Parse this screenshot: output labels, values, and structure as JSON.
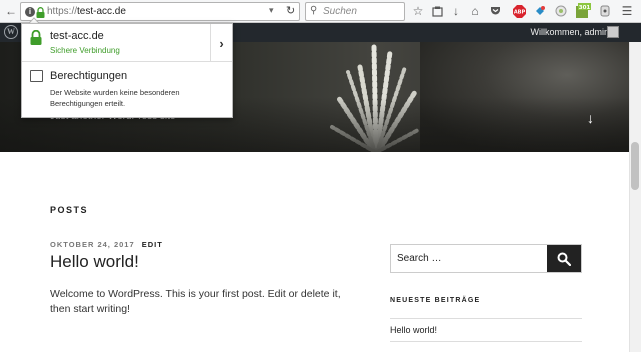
{
  "browser": {
    "url_scheme": "https://",
    "url_host": "test-acc.de",
    "search_placeholder": "Suchen",
    "colors": {
      "lock_green": "#3f9d2a"
    }
  },
  "toolbar_icons": [
    "back-icon",
    "bookmark-star-icon",
    "reading-list-icon",
    "download-icon",
    "home-icon",
    "pocket-icon",
    "adblock-icon",
    "extension-icon",
    "extension-icon",
    "extension-icon",
    "menu-icon"
  ],
  "extension_badge": "301",
  "identity_popup": {
    "host": "test-acc.de",
    "connection": "Sichere Verbindung",
    "permissions_title": "Berechtigungen",
    "permissions_text": "Der Website wurden keine besonderen Berechtigungen erteilt."
  },
  "adminbar": {
    "greeting": "Willkommen, admin"
  },
  "hero": {
    "tagline": "Just another WordPress site"
  },
  "content": {
    "section_heading": "POSTS",
    "post": {
      "date": "OKTOBER 24, 2017",
      "edit_label": "EDIT",
      "title": "Hello world!",
      "body": "Welcome to WordPress. This is your first post. Edit or delete it, then start writing!"
    }
  },
  "sidebar": {
    "search_placeholder": "Search …",
    "recent_heading": "NEUESTE BEITRÄGE",
    "recent_posts": [
      "Hello world!"
    ]
  }
}
